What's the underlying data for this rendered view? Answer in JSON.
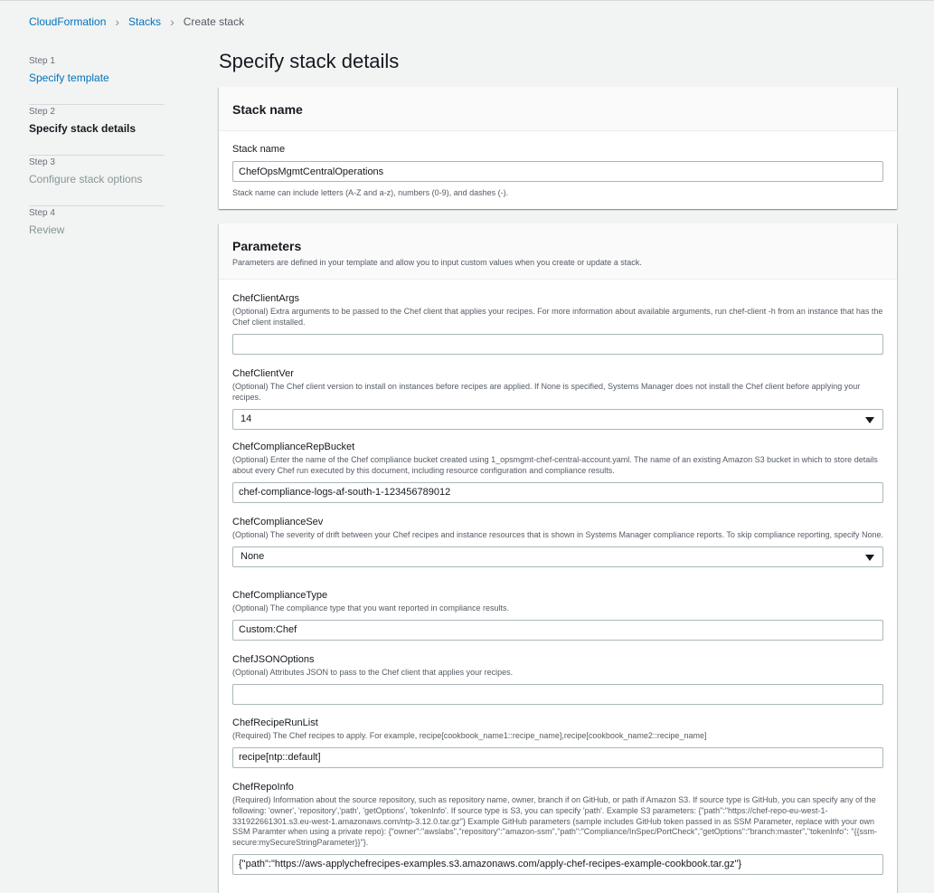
{
  "breadcrumb": {
    "items": [
      "CloudFormation",
      "Stacks"
    ],
    "current": "Create stack"
  },
  "steps": [
    {
      "num": "Step 1",
      "label": "Specify template"
    },
    {
      "num": "Step 2",
      "label": "Specify stack details"
    },
    {
      "num": "Step 3",
      "label": "Configure stack options"
    },
    {
      "num": "Step 4",
      "label": "Review"
    }
  ],
  "page_title": "Specify stack details",
  "stack_name_panel": {
    "title": "Stack name",
    "field_label": "Stack name",
    "value": "ChefOpsMgmtCentralOperations",
    "constraint": "Stack name can include letters (A-Z and a-z), numbers (0-9), and dashes (-)."
  },
  "parameters_panel": {
    "title": "Parameters",
    "description": "Parameters are defined in your template and allow you to input custom values when you create or update a stack.",
    "params": [
      {
        "name": "ChefClientArgs",
        "desc": "(Optional) Extra arguments to be passed to the Chef client that applies your recipes. For more information about available arguments, run chef-client -h from an instance that has the Chef client installed.",
        "value": ""
      },
      {
        "name": "ChefClientVer",
        "desc": "(Optional) The Chef client version to install on instances before recipes are applied. If None is specified, Systems Manager does not install the Chef client before applying your recipes.",
        "value": "14"
      },
      {
        "name": "ChefComplianceRepBucket",
        "desc": "(Optional) Enter the name of the Chef compliance bucket created using 1_opsmgmt-chef-central-account.yaml. The name of an existing Amazon S3 bucket in which to store details about every Chef run executed by this document, including resource configuration and compliance results.",
        "value": "chef-compliance-logs-af-south-1-123456789012"
      },
      {
        "name": "ChefComplianceSev",
        "desc": "(Optional) The severity of drift between your Chef recipes and instance resources that is shown in Systems Manager compliance reports. To skip compliance reporting, specify None.",
        "value": "None"
      },
      {
        "name": "ChefComplianceType",
        "desc": "(Optional) The compliance type that you want reported in compliance results.",
        "value": "Custom:Chef"
      },
      {
        "name": "ChefJSONOptions",
        "desc": "(Optional) Attributes JSON to pass to the Chef client that applies your recipes.",
        "value": ""
      },
      {
        "name": "ChefRecipeRunList",
        "desc": "(Required) The Chef recipes to apply. For example, recipe[cookbook_name1::recipe_name],recipe[cookbook_name2::recipe_name]",
        "value": "recipe[ntp::default]"
      },
      {
        "name": "ChefRepoInfo",
        "desc": "(Required) Information about the source repository, such as repository name, owner, branch if on GitHub, or path if Amazon S3. If source type is GitHub, you can specify any of the following: 'owner', 'repository','path', 'getOptions', 'tokenInfo'. If source type is S3, you can specify 'path'. Example S3 parameters: {\"path\":\"https://chef-repo-eu-west-1-331922661301.s3.eu-west-1.amazonaws.com/ntp-3.12.0.tar.gz\"} Example GitHub parameters (sample includes GitHub token passed in as SSM Parameter, replace with your own SSM Paramter when using a private repo): {\"owner\":\"awslabs\",\"repository\":\"amazon-ssm\",\"path\":\"Compliance/InSpec/PortCheck\",\"getOptions\":\"branch:master\",\"tokenInfo\": \"{{ssm-secure:mySecureStringParameter}}\"}.",
        "value": "{\"path\":\"https://aws-applychefrecipes-examples.s3.amazonaws.com/apply-chef-recipes-example-cookbook.tar.gz\"}"
      }
    ]
  },
  "icons": {
    "breadcrumb_separator": "chevron-right-icon",
    "select_caret": "caret-down-icon"
  }
}
